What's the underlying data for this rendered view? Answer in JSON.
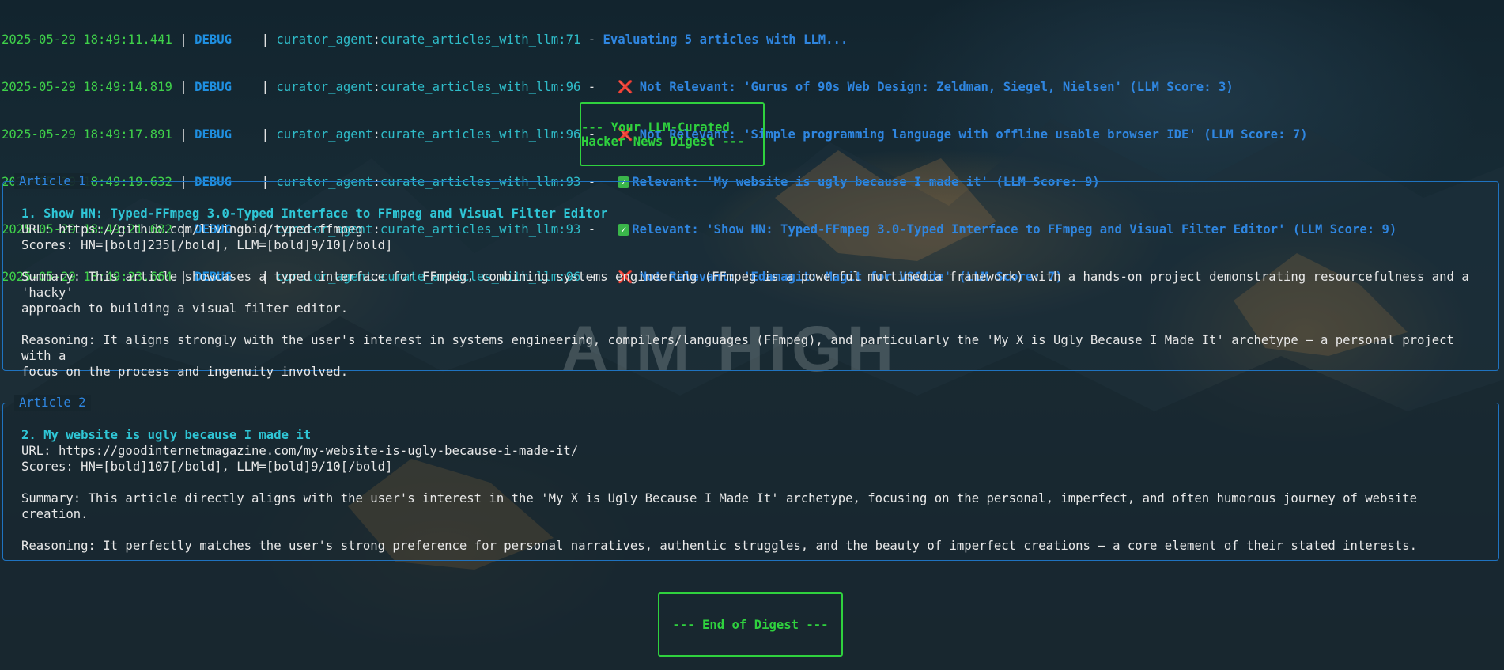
{
  "log": [
    {
      "ts": "2025-05-29 18:49:11.441",
      "level": "DEBUG",
      "module": "curator_agent",
      "func": "curate_articles_with_llm:71",
      "mark": "",
      "message": "Evaluating 5 articles with LLM..."
    },
    {
      "ts": "2025-05-29 18:49:14.819",
      "level": "DEBUG",
      "module": "curator_agent",
      "func": "curate_articles_with_llm:96",
      "mark": "x",
      "message": "Not Relevant: 'Gurus of 90s Web Design: Zeldman, Siegel, Nielsen' (LLM Score: 3)"
    },
    {
      "ts": "2025-05-29 18:49:17.891",
      "level": "DEBUG",
      "module": "curator_agent",
      "func": "curate_articles_with_llm:96",
      "mark": "x",
      "message": "Not Relevant: 'Simple programming language with offline usable browser IDE' (LLM Score: 7)"
    },
    {
      "ts": "2025-05-29 18:49:19.632",
      "level": "DEBUG",
      "module": "curator_agent",
      "func": "curate_articles_with_llm:93",
      "mark": "ok",
      "message": "Relevant: 'My website is ugly because I made it' (LLM Score: 9)"
    },
    {
      "ts": "2025-05-29 18:49:21.682",
      "level": "DEBUG",
      "module": "curator_agent",
      "func": "curate_articles_with_llm:93",
      "mark": "ok",
      "message": "Relevant: 'Show HN: Typed-FFmpeg 3.0-Typed Interface to FFmpeg and Visual Filter Editor' (LLM Score: 9)"
    },
    {
      "ts": "2025-05-29 18:49:23.664",
      "level": "DEBUG",
      "module": "curator_agent",
      "func": "curate_articles_with_llm:96",
      "mark": "x",
      "message": "Not Relevant: 'Edamagit: Magit for VSCode' (LLM Score: 7)"
    }
  ],
  "marks": {
    "x": "❌",
    "ok": "✓"
  },
  "digest_header": "--- Your LLM-Curated Hacker News Digest ---",
  "digest_footer": "--- End of Digest ---",
  "watermark": "AIM HIGH",
  "articles": [
    {
      "panel_title": "Article 1",
      "title": "1. Show HN: Typed-FFmpeg 3.0-Typed Interface to FFmpeg and Visual Filter Editor",
      "url": "URL: https://github.com/livingbio/typed-ffmpeg",
      "scores": "Scores: HN=[bold]235[/bold], LLM=[bold]9/10[/bold]",
      "summary_1": "Summary: This article showcases a typed interface for FFmpeg, combining systems engineering (FFmpeg is a powerful multimedia framework) with a hands-on project demonstrating resourcefulness and a 'hacky'",
      "summary_2": "approach to building a visual filter editor.",
      "reasoning_1": "Reasoning: It aligns strongly with the user's interest in systems engineering, compilers/languages (FFmpeg), and particularly the 'My X is Ugly Because I Made It' archetype – a personal project with a",
      "reasoning_2": "focus on the process and ingenuity involved."
    },
    {
      "panel_title": "Article 2",
      "title": "2. My website is ugly because I made it",
      "url": "URL: https://goodinternetmagazine.com/my-website-is-ugly-because-i-made-it/",
      "scores": "Scores: HN=[bold]107[/bold], LLM=[bold]9/10[/bold]",
      "summary_1": "Summary: This article directly aligns with the user's interest in the 'My X is Ugly Because I Made It' archetype, focusing on the personal, imperfect, and often humorous journey of website creation.",
      "reasoning_1": "Reasoning: It perfectly matches the user's strong preference for personal narratives, authentic struggles, and the beauty of imperfect creations – a core element of their stated interests."
    }
  ],
  "colors": {
    "timestamp": "#3fd14a",
    "level": "#1f8fe0",
    "module": "#2fbcc9",
    "accent_green": "#2fd13e",
    "panel_border": "#1f73c0",
    "title_cyan": "#2fc6d6"
  }
}
